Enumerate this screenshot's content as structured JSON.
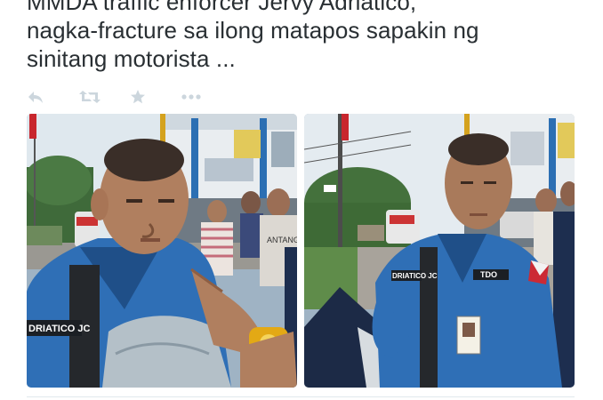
{
  "tweet": {
    "text_lines": [
      "MMDA traffic enforcer Jervy Adriatico,",
      "nagka-fracture sa ilong matapos sapakin ng",
      "sinitang motorista ..."
    ]
  },
  "actions": [
    {
      "name": "reply",
      "icon": "reply-icon"
    },
    {
      "name": "retweet",
      "icon": "retweet-icon"
    },
    {
      "name": "favorite",
      "icon": "star-icon"
    },
    {
      "name": "more",
      "icon": "more-icon"
    }
  ],
  "photos": {
    "left": {
      "name_tag": "DRIATICO JC",
      "background_sign": "ANTANG"
    },
    "right": {
      "name_tag": "DRIATICO JC",
      "badge_text": "TDO"
    }
  },
  "colors": {
    "text": "#292f33",
    "icon_gray": "#ccd6dd",
    "uniform_blue": "#2f6fb6",
    "divider": "#e1e8ed"
  }
}
